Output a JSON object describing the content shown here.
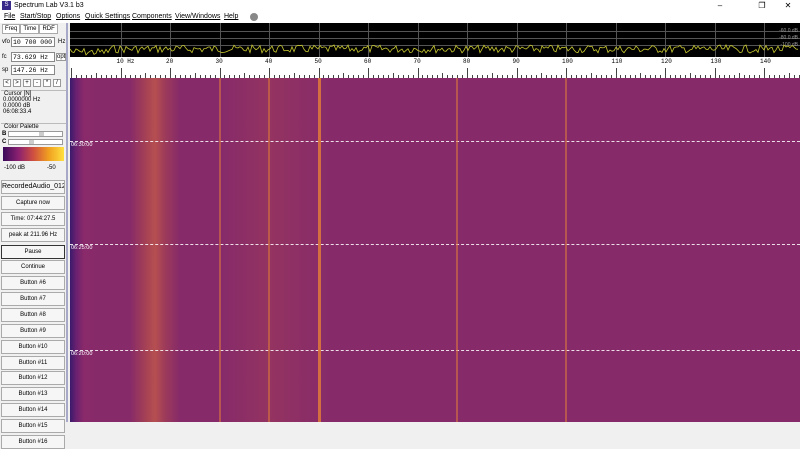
{
  "window": {
    "title": "Spectrum Lab V3.1 b3",
    "minimize": "–",
    "restore": "❐",
    "close": "✕"
  },
  "menu": [
    "File",
    "Start/Stop",
    "Options",
    "Quick Settings",
    "Components",
    "View/Windows",
    "Help"
  ],
  "left": {
    "tabs": [
      "Freq",
      "Time",
      "RDF"
    ],
    "vfo_label": "vfo",
    "vfo_value": "10 700 000",
    "vfo_unit": "Hz",
    "fc_label": "fc",
    "fc_value": "73.629 Hz",
    "opt": "opt",
    "sp_label": "sp",
    "sp_value": "147.26 Hz",
    "nav": [
      "<",
      ">",
      "+",
      "-",
      "*",
      "/"
    ],
    "cursor_title": "Cursor [N]",
    "cursor_freq": "0.0000000 Hz",
    "cursor_db": "0.0000 dB",
    "cursor_time": "06:08:33.4",
    "palette_title": "Color Palette",
    "b_label": "B",
    "c_label": "C",
    "palette_min": "-100 dB",
    "palette_max": "-50",
    "buttons": [
      "RecordedAudio_012...",
      "Capture now",
      "Time:  07:44:27.5",
      "peak at 211.96 Hz",
      "Pause",
      "Continue",
      "Button #6",
      "Button #7",
      "Button #8",
      "Button #9",
      "Button #10",
      "Button #11",
      "Button #12",
      "Button #13",
      "Button #14",
      "Button #15",
      "Button #16"
    ]
  },
  "spectrum": {
    "db_labels": [
      "-60.0 dB",
      "-80.0 dB",
      "-100 dB"
    ],
    "accent": "#c8c832"
  },
  "axis": {
    "labels": [
      "10 Hz",
      "20",
      "30",
      "40",
      "50",
      "60",
      "70",
      "80",
      "90",
      "100",
      "110",
      "120",
      "130",
      "140"
    ]
  },
  "waterfall": {
    "time_labels": [
      "06:30:00",
      "06:25:00",
      "06:20:00"
    ],
    "lines_hz": [
      30,
      40,
      50,
      78,
      100
    ]
  }
}
